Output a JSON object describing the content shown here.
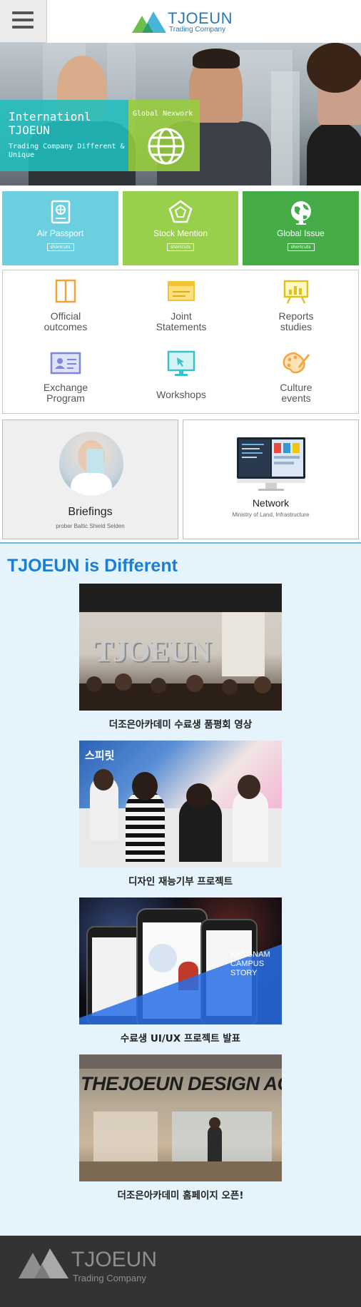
{
  "header": {
    "brand": "TJOEUN",
    "tagline": "Trading Company",
    "menu_icon": "hamburger-icon"
  },
  "hero": {
    "title": "Internationl TJOEUN",
    "subtitle": "Trading Company Different & Unique",
    "badge": "Global Nexwork"
  },
  "shortcuts": [
    {
      "label": "Air Passport",
      "button": "shortcuts",
      "icon": "passport-icon",
      "color": "#6ccfe0"
    },
    {
      "label": "Stock Mention",
      "button": "shortcuts",
      "icon": "pentagon-icon",
      "color": "#98cf4b"
    },
    {
      "label": "Global Issue",
      "button": "shortcuts",
      "icon": "globe-icon",
      "color": "#45ac48"
    }
  ],
  "grid": [
    {
      "label1": "Official",
      "label2": "outcomes",
      "icon": "door-icon"
    },
    {
      "label1": "Joint",
      "label2": "Statements",
      "icon": "document-icon"
    },
    {
      "label1": "Reports",
      "label2": "studies",
      "icon": "presentation-board-icon"
    },
    {
      "label1": "Exchange",
      "label2": "Program",
      "icon": "id-card-icon"
    },
    {
      "label1": "Workshops",
      "label2": "",
      "icon": "monitor-icon"
    },
    {
      "label1": "Culture",
      "label2": "events",
      "icon": "palette-icon"
    }
  ],
  "briefings": {
    "title": "Briefings",
    "desc": "prober Baltic Shield Selden"
  },
  "network": {
    "title": "Network",
    "desc": "Ministry of Land, Infrastructure"
  },
  "different": {
    "title": "TJOEUN is Different",
    "items": [
      {
        "caption": "더조은아카데미 수료생 품평회 영상",
        "image_text": "TJOEUN"
      },
      {
        "caption": "디자인 재능기부 프로젝트",
        "image_text": "스피릿"
      },
      {
        "caption": "수료생 UI/UX 프로젝트 발표",
        "image_text": "KANGNAM CAMPUS STORY"
      },
      {
        "caption": "더조은아카데미 홈페이지 오픈!",
        "image_text": "THEJOEUN DESIGN ACAD"
      }
    ]
  },
  "footer": {
    "brand": "TJOEUN",
    "tagline": "Trading Company"
  },
  "colors": {
    "accent": "#1a7fd2",
    "brand": "#2b79b0",
    "teal": "#20bebe",
    "green": "#96cd3c",
    "footer": "#333333"
  }
}
